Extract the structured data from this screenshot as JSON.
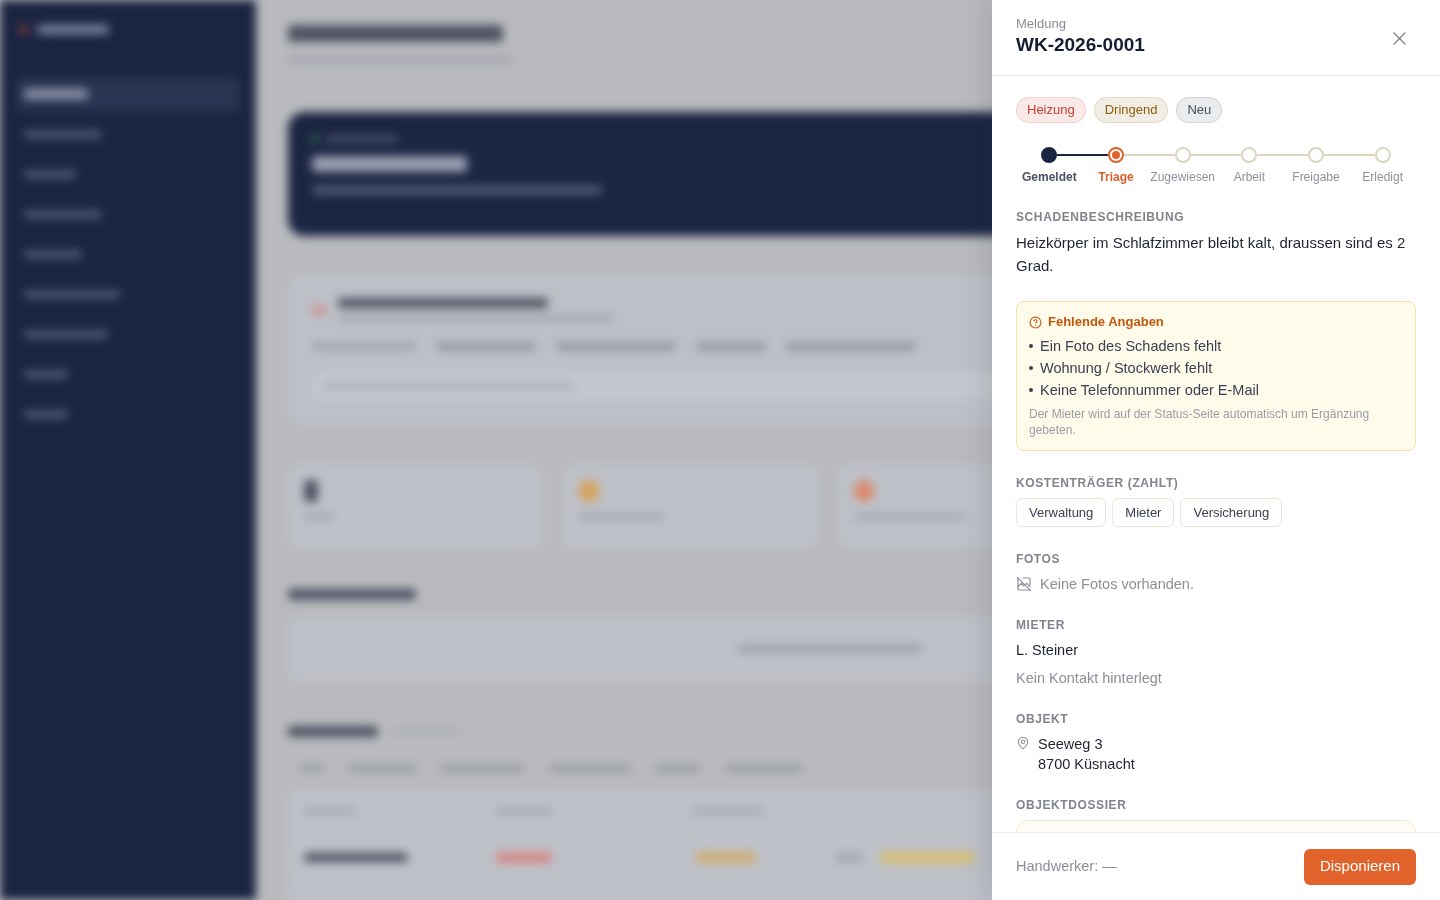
{
  "drawer": {
    "eyebrow": "Meldung",
    "title": "WK-2026-0001"
  },
  "tags": [
    {
      "label": "Heizung",
      "color": "#c43d2e"
    },
    {
      "label": "Dringend",
      "color": "#8b5e0b"
    },
    {
      "label": "Neu",
      "color": "#4a4f5c"
    }
  ],
  "steps": [
    {
      "label": "Gemeldet",
      "completed": true,
      "current": false
    },
    {
      "label": "Triage",
      "completed": false,
      "current": true
    },
    {
      "label": "Zugewiesen",
      "completed": false,
      "current": false
    },
    {
      "label": "Arbeit",
      "completed": false,
      "current": false
    },
    {
      "label": "Freigabe",
      "completed": false,
      "current": false
    },
    {
      "label": "Erledigt",
      "completed": false,
      "current": false
    }
  ],
  "description": {
    "label": "SCHADENBESCHREIBUNG",
    "text": "Heizkörper im Schlafzimmer bleibt kalt, draussen sind es 2 Grad."
  },
  "missing_info": {
    "title": "Fehlende Angaben",
    "items": [
      "Ein Foto des Schadens fehlt",
      "Wohnung / Stockwerk fehlt",
      "Keine Telefonnummer oder E-Mail"
    ],
    "note": "Der Mieter wird auf der Status-Seite automatisch um Ergänzung gebeten."
  },
  "cost_bearer": {
    "label": "KOSTENTRÄGER (ZAHLT)",
    "options": [
      {
        "label": "Verwaltung",
        "selected": false
      },
      {
        "label": "Mieter",
        "selected": false
      },
      {
        "label": "Versicherung",
        "selected": false
      }
    ]
  },
  "photos": {
    "label": "FOTOS",
    "empty_text": "Keine Fotos vorhanden."
  },
  "tenant": {
    "label": "MIETER",
    "name": "L. Steiner",
    "contact": "Kein Kontakt hinterlegt"
  },
  "property": {
    "label": "OBJEKT",
    "address_lines": [
      "Seeweg 3",
      "8700 Küsnacht"
    ]
  },
  "dossier": {
    "label": "OBJEKTDOSSIER"
  },
  "footer": {
    "assignee": "Handwerker: —",
    "action": "Disponieren"
  }
}
